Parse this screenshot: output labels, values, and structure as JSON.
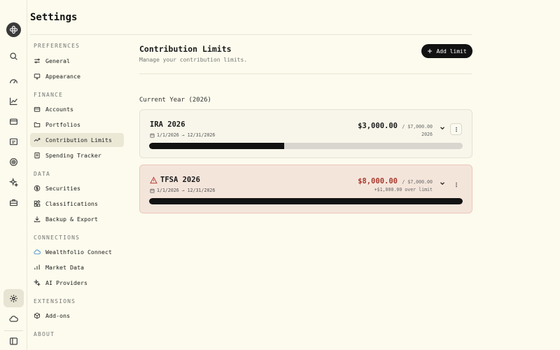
{
  "page": {
    "title": "Settings"
  },
  "rail": {
    "icons": [
      "app-logo-icon",
      "search-icon",
      "dashboard-icon",
      "chart-icon",
      "wallet-icon",
      "accounts-icon",
      "goals-icon",
      "sparkle-icon",
      "briefcase-icon",
      "settings-icon",
      "cloud-icon",
      "sidebar-toggle-icon"
    ]
  },
  "nav": {
    "sections": {
      "preferences": "PREFERENCES",
      "finance": "FINANCE",
      "data": "DATA",
      "connections": "CONNECTIONS",
      "extensions": "EXTENSIONS",
      "about": "ABOUT"
    },
    "items": {
      "general": "General",
      "appearance": "Appearance",
      "accounts": "Accounts",
      "portfolios": "Portfolios",
      "contribution_limits": "Contribution Limits",
      "spending_tracker": "Spending Tracker",
      "securities": "Securities",
      "classifications": "Classifications",
      "backup_export": "Backup & Export",
      "wealthfolio_connect": "Wealthfolio Connect",
      "market_data": "Market Data",
      "ai_providers": "AI Providers",
      "addons": "Add-ons"
    },
    "active": "contribution_limits"
  },
  "main": {
    "title": "Contribution Limits",
    "subtitle": "Manage your contribution limits.",
    "add_button": "Add limit",
    "section_label": "Current Year (2026)"
  },
  "limits": [
    {
      "name": "IRA 2026",
      "dates": "1/1/2026 → 12/31/2026",
      "amount": "$3,000.00",
      "of_limit": "/ $7,000.00",
      "note": "2026",
      "progress": 0.43,
      "over": false
    },
    {
      "name": "TFSA 2026",
      "dates": "1/1/2026 → 12/31/2026",
      "amount": "$8,000.00",
      "of_limit": "/ $7,000.00",
      "note": "+$1,000.00 over limit",
      "progress": 1.0,
      "over": true
    }
  ],
  "colors": {
    "background": "#fcfbed",
    "accent": "#121212",
    "over_limit": "#a83a2e",
    "warning_icon": "#b8453a"
  }
}
